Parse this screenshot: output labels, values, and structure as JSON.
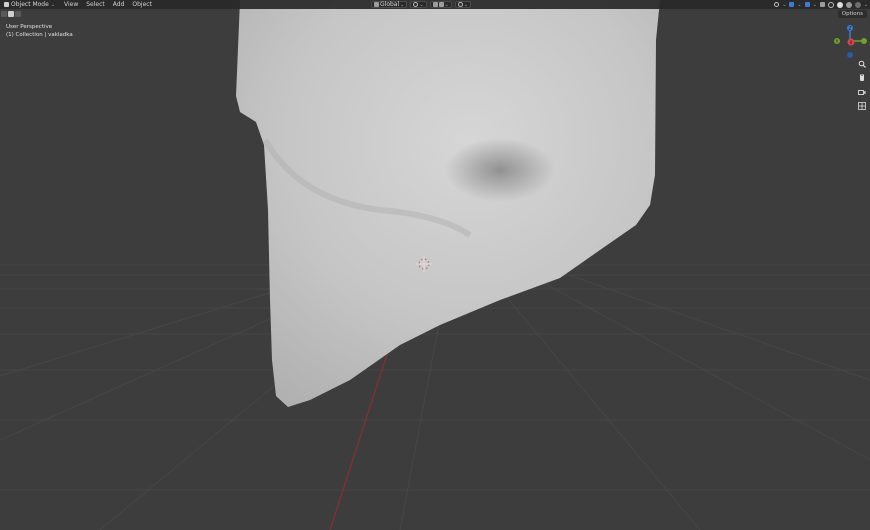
{
  "header": {
    "mode": "Object Mode",
    "menu": [
      "View",
      "Select",
      "Add",
      "Object"
    ],
    "orientation": "Global"
  },
  "overlay": {
    "perspective": "User Perspective",
    "collection": "(1) Collection | vakladka"
  },
  "options_label": "Options",
  "gizmo_axes": [
    "X",
    "Y",
    "Z"
  ],
  "colors": {
    "background": "#3d3d3d",
    "grid": "#474747",
    "x_axis": "#8a2e35",
    "mesh": "#c8c8c8",
    "gizmo_x": "#d64550",
    "gizmo_y": "#6fa12b",
    "gizmo_z": "#3c7bd6"
  },
  "icons": [
    "move-icon",
    "camera-icon",
    "grid-icon",
    "zoom-icon",
    "hand-icon"
  ]
}
